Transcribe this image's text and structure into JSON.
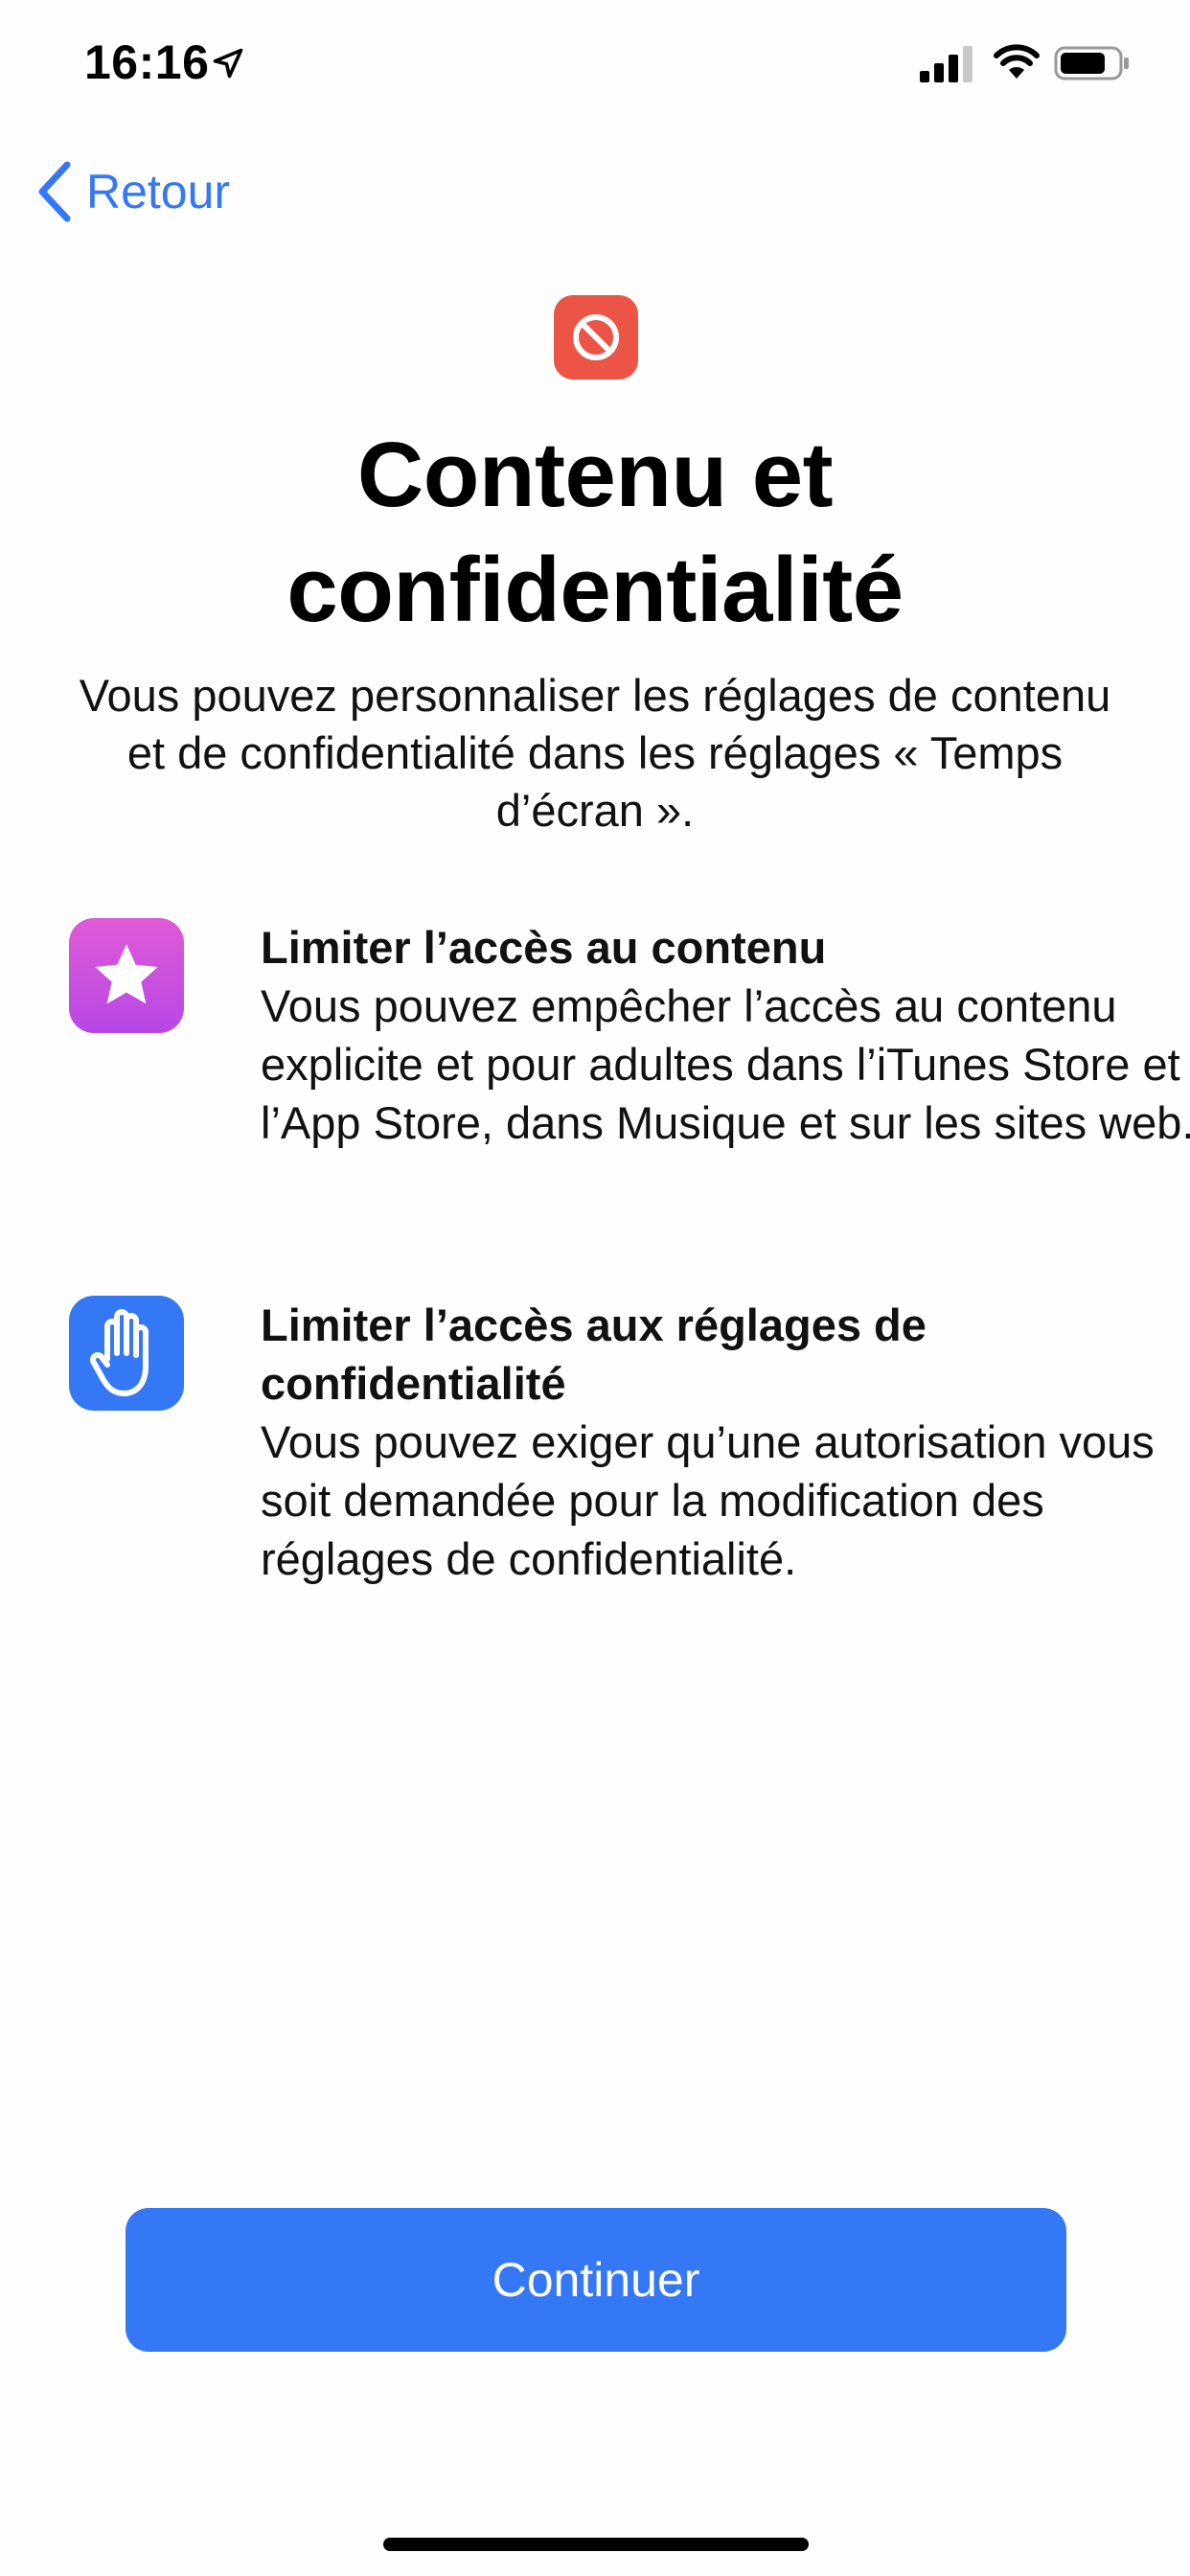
{
  "status_bar": {
    "time": "16:16",
    "icons": [
      "location-arrow-icon",
      "cellular-signal-icon",
      "wifi-icon",
      "battery-icon"
    ]
  },
  "nav": {
    "back_label": "Retour"
  },
  "header": {
    "icon": "restricted-icon",
    "title": "Contenu et confidentialité",
    "subtitle": "Vous pouvez personnaliser les réglages de contenu et de confidentialité dans les réglages « Temps d’écran »."
  },
  "features": [
    {
      "icon": "star-icon",
      "title": "Limiter l’accès au contenu",
      "description": "Vous pouvez empêcher l’accès au contenu explicite et pour adultes dans l’iTunes Store et l’App Store, dans Musique et sur les sites web."
    },
    {
      "icon": "hand-icon",
      "title": "Limiter l’accès aux réglages de confidentialité",
      "description": "Vous pouvez exiger qu’une autorisation vous soit demandée pour la modification des réglages de confidentialité."
    }
  ],
  "actions": {
    "continue_label": "Continuer"
  },
  "colors": {
    "accent": "#3478f6",
    "header_icon_bg": "#ec5446",
    "star_icon_bg": "#c94fe0"
  }
}
